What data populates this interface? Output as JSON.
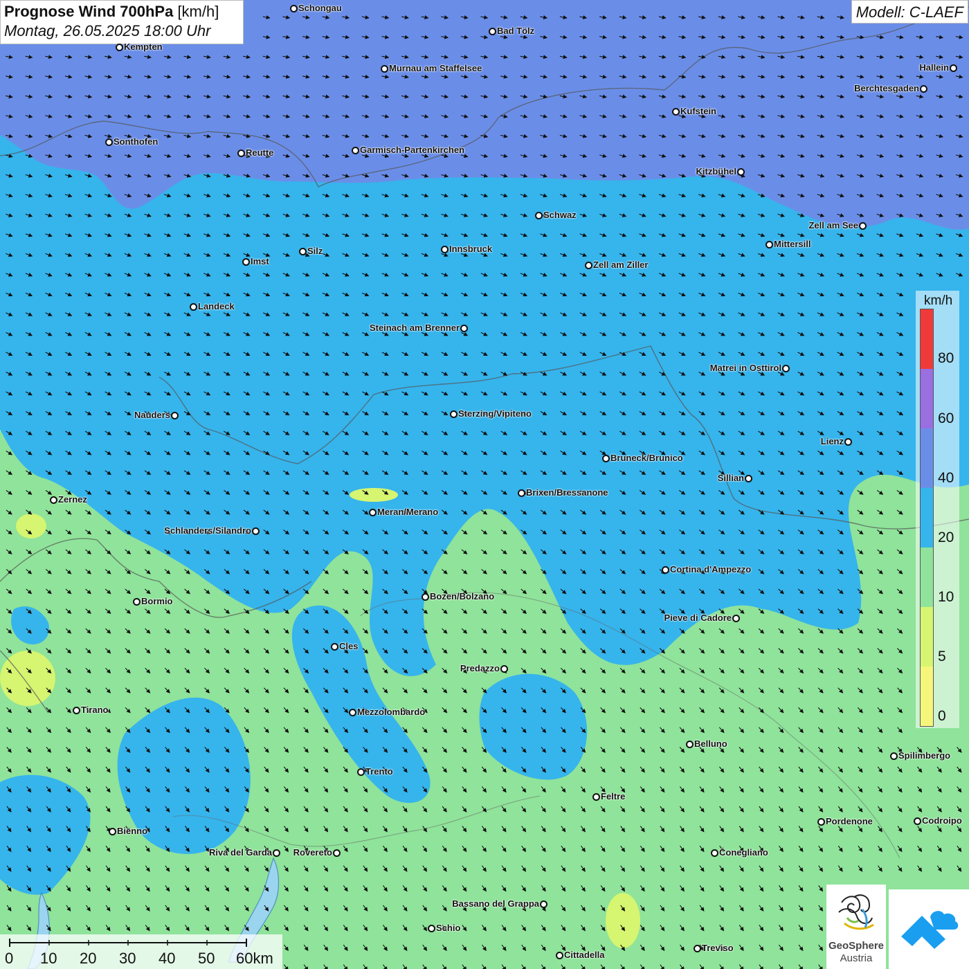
{
  "header": {
    "title": "Prognose Wind 700hPa",
    "unit": "[km/h]",
    "datetime": "Montag, 26.05.2025 18:00 Uhr"
  },
  "model": "Modell: C-LAEF",
  "legend": {
    "unit": "km/h",
    "labels": [
      "80",
      "60",
      "40",
      "20",
      "10",
      "5",
      "0"
    ],
    "colors": {
      "0-5": "#f6f77a",
      "5-10": "#d6f570",
      "10-20": "#8fe39a",
      "20-40": "#36b4ec",
      "40-60": "#6a8ee8",
      "60-80": "#9a6fe0",
      "80+": "#f03a3a"
    }
  },
  "scale": {
    "labels": [
      "0",
      "10",
      "20",
      "30",
      "40",
      "50",
      "60km"
    ]
  },
  "logo": {
    "name_line1": "GeoSphere",
    "name_line2": "Austria"
  },
  "cities": [
    {
      "name": "Schongau",
      "dot": "left"
    },
    {
      "name": "Bad Tölz",
      "dot": "left"
    },
    {
      "name": "Kempten",
      "dot": "left"
    },
    {
      "name": "Murnau am Staffelsee",
      "dot": "left"
    },
    {
      "name": "Hallein",
      "dot": "right"
    },
    {
      "name": "Berchtesgaden",
      "dot": "right"
    },
    {
      "name": "Kufstein",
      "dot": "left"
    },
    {
      "name": "Sonthofen",
      "dot": "left"
    },
    {
      "name": "Reutte",
      "dot": "left"
    },
    {
      "name": "Garmisch-Partenkirchen",
      "dot": "left"
    },
    {
      "name": "Kitzbühel",
      "dot": "right"
    },
    {
      "name": "Schwaz",
      "dot": "left"
    },
    {
      "name": "Zell am See",
      "dot": "right"
    },
    {
      "name": "Mittersill",
      "dot": "left"
    },
    {
      "name": "Innsbruck",
      "dot": "left"
    },
    {
      "name": "Silz",
      "dot": "left"
    },
    {
      "name": "Imst",
      "dot": "left"
    },
    {
      "name": "Zell am Ziller",
      "dot": "left"
    },
    {
      "name": "Landeck",
      "dot": "left"
    },
    {
      "name": "Steinach am Brenner",
      "dot": "right"
    },
    {
      "name": "Matrei in Osttirol",
      "dot": "right"
    },
    {
      "name": "Nauders",
      "dot": "right"
    },
    {
      "name": "Sterzing/Vipiteno",
      "dot": "left"
    },
    {
      "name": "Lienz",
      "dot": "right"
    },
    {
      "name": "Bruneck/Brunico",
      "dot": "left"
    },
    {
      "name": "Sillian",
      "dot": "right"
    },
    {
      "name": "Zernez",
      "dot": "left"
    },
    {
      "name": "Brixen/Bressanone",
      "dot": "left"
    },
    {
      "name": "Meran/Merano",
      "dot": "left"
    },
    {
      "name": "Schlanders/Silandro",
      "dot": "right"
    },
    {
      "name": "Cortina d'Ampezzo",
      "dot": "left"
    },
    {
      "name": "Bozen/Bolzano",
      "dot": "left"
    },
    {
      "name": "Bormio",
      "dot": "left"
    },
    {
      "name": "Pieve di Cadore",
      "dot": "right"
    },
    {
      "name": "Cles",
      "dot": "left"
    },
    {
      "name": "Predazzo",
      "dot": "right"
    },
    {
      "name": "Tirano",
      "dot": "left"
    },
    {
      "name": "Mezzolombardo",
      "dot": "left"
    },
    {
      "name": "Belluno",
      "dot": "left"
    },
    {
      "name": "Spilimbergo",
      "dot": "left"
    },
    {
      "name": "Trento",
      "dot": "left"
    },
    {
      "name": "Feltre",
      "dot": "left"
    },
    {
      "name": "Pordenone",
      "dot": "left"
    },
    {
      "name": "Codroipo",
      "dot": "left"
    },
    {
      "name": "Bienno",
      "dot": "left"
    },
    {
      "name": "Riva del Garda",
      "dot": "right"
    },
    {
      "name": "Rovereto",
      "dot": "right"
    },
    {
      "name": "Conegliano",
      "dot": "left"
    },
    {
      "name": "Bassano del Grappa",
      "dot": "right"
    },
    {
      "name": "Schio",
      "dot": "left"
    },
    {
      "name": "Treviso",
      "dot": "left"
    },
    {
      "name": "Cittadella",
      "dot": "left"
    }
  ]
}
